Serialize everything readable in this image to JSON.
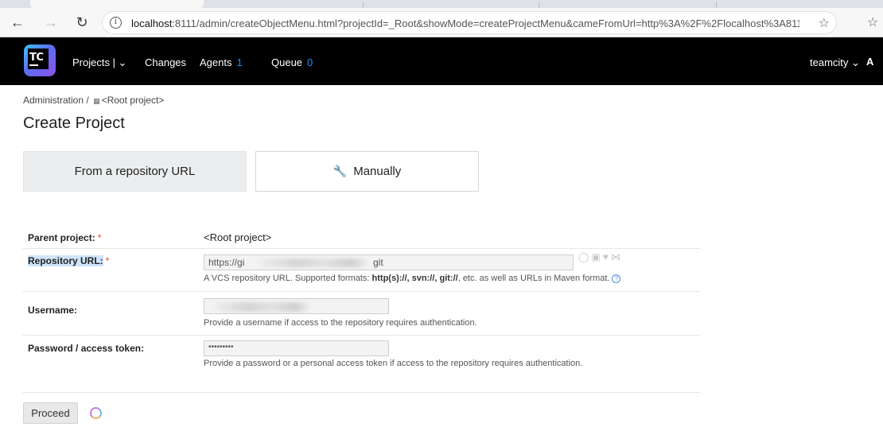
{
  "browser": {
    "back_icon": "arrow-left-icon",
    "forward_icon": "arrow-right-icon",
    "reload_icon": "reload-icon",
    "url_host": "localhost",
    "url_rest": ":8111/admin/createObjectMenu.html?projectId=_Root&showMode=createProjectMenu&cameFromUrl=http%3A%2F%2Flocalhost%3A8111%2Fov..."
  },
  "header": {
    "nav": [
      {
        "label": "Projects | ⌄"
      },
      {
        "label": "Changes"
      },
      {
        "label": "Agents",
        "count": "1"
      },
      {
        "label": "Queue",
        "count": "0"
      }
    ],
    "user": "teamcity ⌄",
    "user_cut": "A",
    "logo_text": "TC"
  },
  "breadcrumb": {
    "admin": "Administration",
    "separator": "/",
    "project": "<Root project>"
  },
  "page": {
    "title": "Create Project"
  },
  "modes": {
    "repo_url": "From a repository URL",
    "manual": "Manually"
  },
  "form": {
    "parent": {
      "label": "Parent project:",
      "required": "*",
      "value": "<Root project>"
    },
    "repo": {
      "label": "Repository URL:",
      "required": "*",
      "value_start": "https://gi",
      "value_end": "git",
      "hint_pre": "A VCS repository URL. Supported formats: ",
      "hint_formats": "http(s)://, svn://, git://",
      "hint_post": ", etc. as well as URLs in Maven format."
    },
    "username": {
      "label": "Username:",
      "hint": "Provide a username if access to the repository requires authentication."
    },
    "password": {
      "label": "Password / access token:",
      "value": "•••••••••",
      "hint": "Provide a password or a personal access token if access to the repository requires authentication."
    }
  },
  "actions": {
    "proceed": "Proceed"
  },
  "colors": {
    "header_bg": "#000000",
    "counter": "#1e90ff",
    "required": "#e2433a",
    "active_mode_bg": "#ebedef"
  }
}
